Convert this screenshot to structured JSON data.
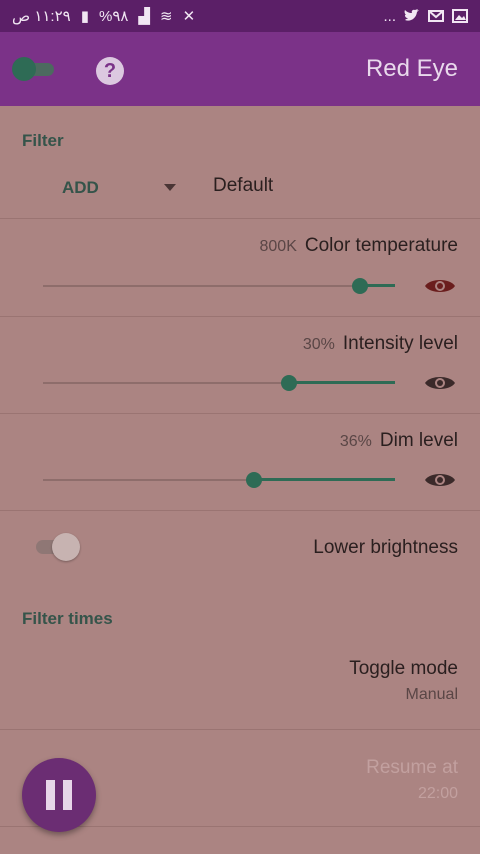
{
  "status_bar": {
    "time": "١١:٢٩ ص",
    "battery": "%٩٨",
    "overflow": "..."
  },
  "app": {
    "title": "Red Eye",
    "help_glyph": "?"
  },
  "filter": {
    "section_title": "Filter",
    "mode": "ADD",
    "preset": "Default"
  },
  "settings": {
    "color_temperature": {
      "label": "Color temperature",
      "value": "800K",
      "level": 0.9
    },
    "intensity": {
      "label": "Intensity level",
      "value": "30%",
      "level": 0.7
    },
    "dim": {
      "label": "Dim level",
      "value": "36%",
      "level": 0.6
    }
  },
  "lower_brightness": {
    "label": "Lower brightness",
    "enabled": false
  },
  "filter_times": {
    "section_title": "Filter times",
    "toggle_mode": {
      "label": "Toggle mode",
      "value": "Manual"
    },
    "resume_at": {
      "label": "Resume at",
      "value": "22:00"
    }
  },
  "colors": {
    "accent": "#2e6b55",
    "app_bar": "#7b3288",
    "status_bar": "#5b1f67",
    "fab": "#6b2d73"
  },
  "icons": [
    "toggle-switch-icon",
    "help-icon",
    "eye-icon",
    "pause-icon"
  ]
}
